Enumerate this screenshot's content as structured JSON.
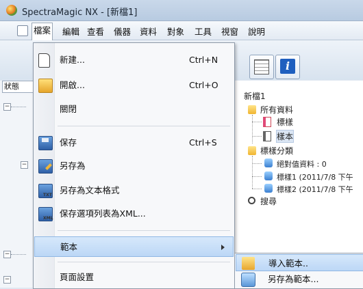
{
  "window": {
    "title": "SpectraMagic NX - [新檔1]"
  },
  "menubar": {
    "items": [
      "檔案",
      "編輯",
      "查看",
      "儀器",
      "資料",
      "對象",
      "工具",
      "視窗",
      "說明"
    ]
  },
  "left_panel": {
    "tab_label": "狀態"
  },
  "file_menu": {
    "new": {
      "label": "新建...",
      "shortcut": "Ctrl+N",
      "icon": "new-document-icon"
    },
    "open": {
      "label": "開啟...",
      "shortcut": "Ctrl+O",
      "icon": "open-folder-icon"
    },
    "close": {
      "label": "關閉"
    },
    "save": {
      "label": "保存",
      "shortcut": "Ctrl+S",
      "icon": "save-icon"
    },
    "save_as": {
      "label": "另存為",
      "icon": "save-as-icon"
    },
    "save_as_text": {
      "label": "另存為文本格式",
      "icon": "save-as-text-icon"
    },
    "save_list_xml": {
      "label": "保存選項列表為XML...",
      "icon": "save-xml-icon"
    },
    "template": {
      "label": "範本"
    },
    "page_setup": {
      "label": "頁面設置"
    }
  },
  "template_submenu": {
    "import": {
      "label": "導入範本..",
      "icon": "import-template-icon"
    },
    "save_as": {
      "label": "另存為範本...",
      "icon": "save-template-icon"
    }
  },
  "tree": {
    "root": "新檔1",
    "all_data": "所有資料",
    "standard": "標樣",
    "sample": "樣本",
    "standard_classification": "標樣分類",
    "absolute_data": "絕對值資料 : 0",
    "standard1": "標樣1 (2011/7/8 下午",
    "standard2": "標樣2 (2011/7/8 下午",
    "search": "搜尋"
  }
}
